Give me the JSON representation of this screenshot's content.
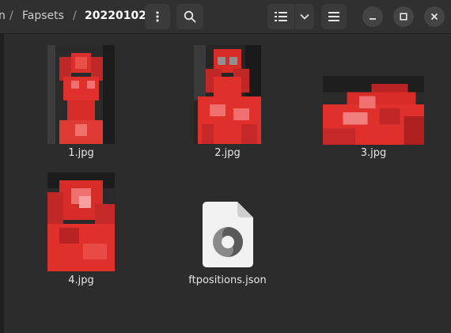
{
  "breadcrumb": {
    "items": [
      "n",
      "Fapsets",
      "20220102"
    ],
    "separator": "/"
  },
  "toolbar": {
    "menu_icon": "vertical-dots-icon",
    "search_icon": "search-icon",
    "view_icon": "list-view-icon",
    "view_dropdown_icon": "chevron-down-icon",
    "main_menu_icon": "hamburger-icon"
  },
  "window_controls": {
    "minimize_icon": "minimize-icon",
    "maximize_icon": "maximize-icon",
    "close_icon": "close-icon"
  },
  "files": [
    {
      "name": "1.jpg",
      "type": "image"
    },
    {
      "name": "2.jpg",
      "type": "image"
    },
    {
      "name": "3.jpg",
      "type": "image"
    },
    {
      "name": "4.jpg",
      "type": "image"
    },
    {
      "name": "ftpositions.json",
      "type": "json",
      "icon": "json-file-icon"
    }
  ],
  "colors": {
    "background": "#2c2c2c",
    "headerbar": "#303030",
    "thumbnail_red": "#e0302c"
  }
}
